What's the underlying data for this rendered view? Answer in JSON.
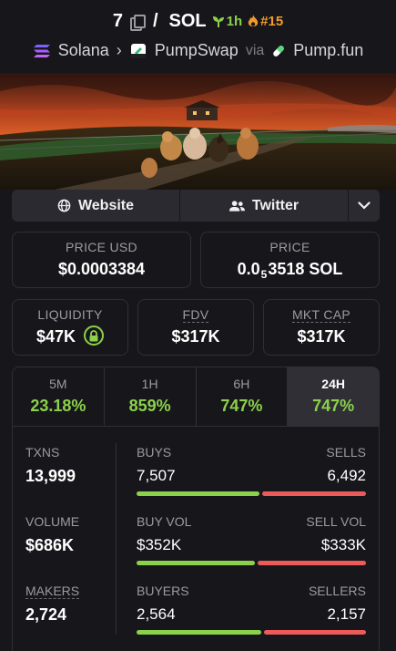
{
  "header": {
    "token_symbol": "7",
    "separator": "/",
    "quote_symbol": "SOL",
    "age": "1h",
    "rank": "#15"
  },
  "breadcrumb": {
    "chain": "Solana",
    "dex": "PumpSwap",
    "via_label": "via",
    "launchpad": "Pump.fun"
  },
  "links": {
    "website_label": "Website",
    "twitter_label": "Twitter"
  },
  "price": {
    "usd_label": "PRICE USD",
    "usd_value": "$0.0003384",
    "native_label": "PRICE",
    "native_prefix": "0.0",
    "native_zero_count": "5",
    "native_digits": "3518 SOL"
  },
  "metrics": {
    "liquidity_label": "LIQUIDITY",
    "liquidity_value": "$47K",
    "fdv_label": "FDV",
    "fdv_value": "$317K",
    "mktcap_label": "MKT CAP",
    "mktcap_value": "$317K"
  },
  "periods": [
    {
      "label": "5M",
      "change": "23.18%"
    },
    {
      "label": "1H",
      "change": "859%"
    },
    {
      "label": "6H",
      "change": "747%"
    },
    {
      "label": "24H",
      "change": "747%",
      "active": true
    }
  ],
  "stats": {
    "txns_label": "TXNS",
    "txns_value": "13,999",
    "volume_label": "VOLUME",
    "volume_value": "$686K",
    "makers_label": "MAKERS",
    "makers_value": "2,724",
    "buys_label": "BUYS",
    "buys_value": "7,507",
    "sells_label": "SELLS",
    "sells_value": "6,492",
    "buy_vol_label": "BUY VOL",
    "buy_vol_value": "$352K",
    "sell_vol_label": "SELL VOL",
    "sell_vol_value": "$333K",
    "buyers_label": "BUYERS",
    "buyers_value": "2,564",
    "sellers_label": "SELLERS",
    "sellers_value": "2,157",
    "buys_share": 0.536,
    "buy_vol_share": 0.514,
    "buyers_share": 0.543
  },
  "colors": {
    "positive": "#8bd14b",
    "negative": "#ec5b59",
    "rank": "#f39a2c",
    "background": "#17171b"
  }
}
